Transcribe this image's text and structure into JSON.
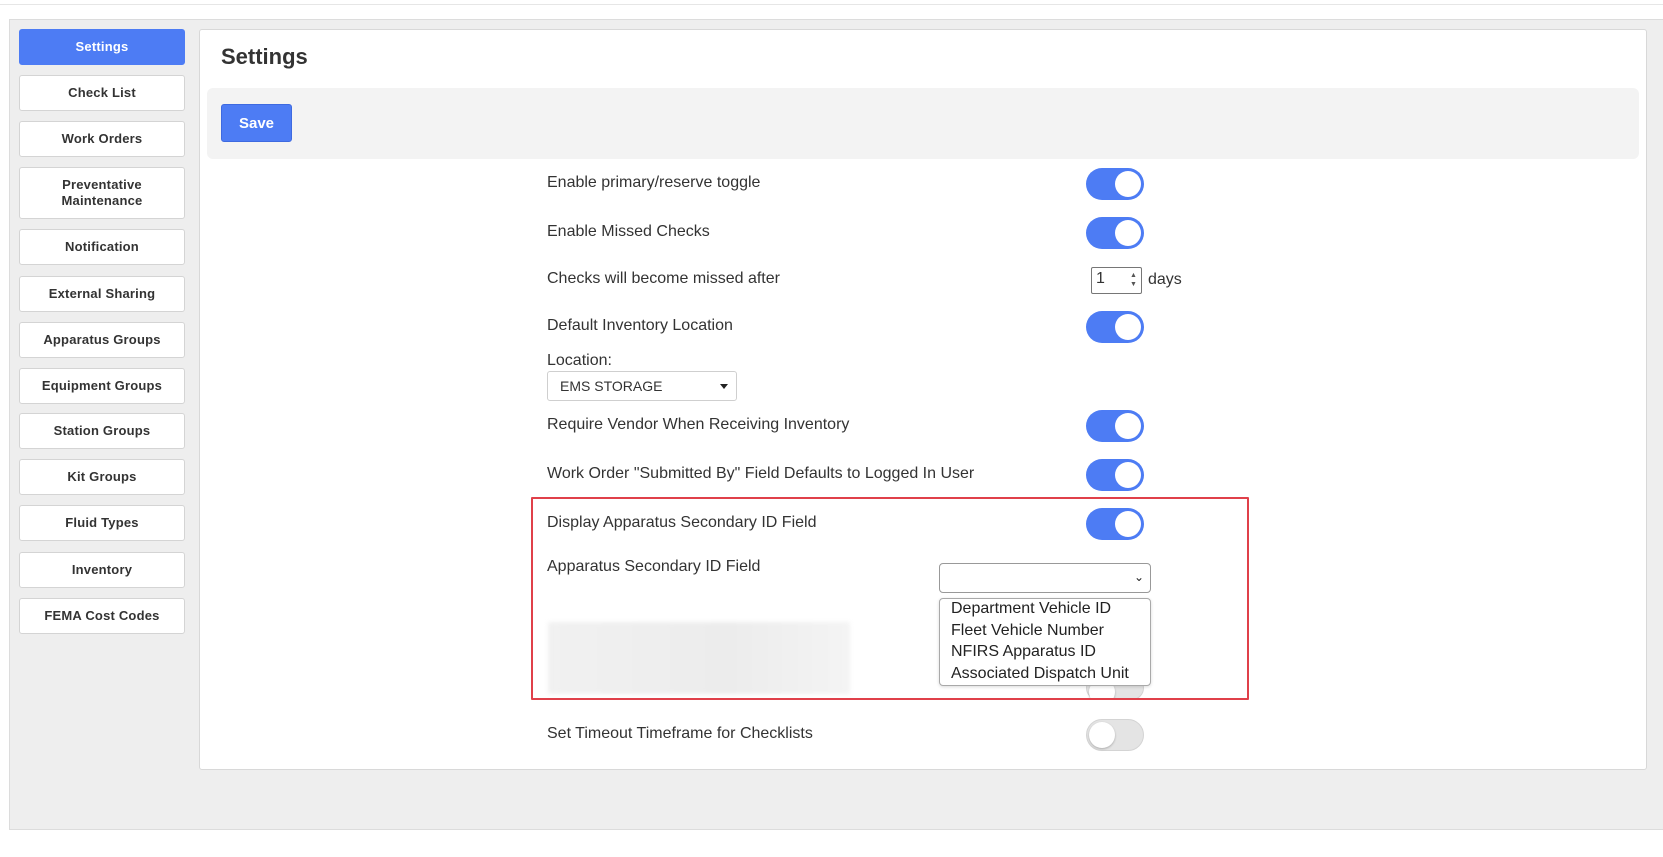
{
  "sidebar": {
    "items": [
      {
        "label": "Settings"
      },
      {
        "label": "Check List"
      },
      {
        "label": "Work Orders"
      },
      {
        "label": "Preventative Maintenance"
      },
      {
        "label": "Notification"
      },
      {
        "label": "External Sharing"
      },
      {
        "label": "Apparatus Groups"
      },
      {
        "label": "Equipment Groups"
      },
      {
        "label": "Station Groups"
      },
      {
        "label": "Kit Groups"
      },
      {
        "label": "Fluid Types"
      },
      {
        "label": "Inventory"
      },
      {
        "label": "FEMA Cost Codes"
      }
    ],
    "active": "Settings"
  },
  "main": {
    "title": "Settings",
    "save_label": "Save",
    "settings": {
      "primary_reserve": {
        "label": "Enable primary/reserve toggle",
        "enabled": true
      },
      "missed_checks": {
        "label": "Enable Missed Checks",
        "enabled": true
      },
      "missed_after": {
        "label": "Checks will become missed after",
        "value": "1",
        "unit": "days"
      },
      "default_inventory": {
        "label": "Default Inventory Location",
        "enabled": true
      },
      "location": {
        "label": "Location:",
        "value": "EMS STORAGE"
      },
      "require_vendor": {
        "label": "Require Vendor When Receiving Inventory",
        "enabled": true
      },
      "submitted_by": {
        "label": "Work Order \"Submitted By\" Field Defaults to Logged In User",
        "enabled": true
      },
      "display_secondary": {
        "label": "Display Apparatus Secondary ID Field",
        "enabled": true
      },
      "secondary_field": {
        "label": "Apparatus Secondary ID Field",
        "value": "",
        "options": [
          "Department Vehicle ID",
          "Fleet Vehicle Number",
          "NFIRS Apparatus ID",
          "Associated Dispatch Unit"
        ]
      },
      "hidden_setting": {
        "enabled": false
      },
      "timeout": {
        "label": "Set Timeout Timeframe for Checklists",
        "enabled": false
      }
    }
  },
  "colors": {
    "accent": "#4d7cf4",
    "highlight_border": "#e0404a",
    "toggle_off": "#e4e4e4"
  }
}
